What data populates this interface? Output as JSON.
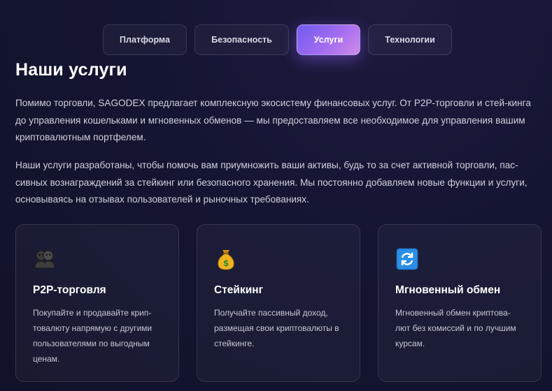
{
  "tabs": [
    {
      "label": "Платформа",
      "active": false
    },
    {
      "label": "Безопасность",
      "active": false
    },
    {
      "label": "Услуги",
      "active": true
    },
    {
      "label": "Технологии",
      "active": false
    }
  ],
  "colors": {
    "background": "#141532",
    "accent_start": "#6f5cf0",
    "accent_end": "#d08ae8",
    "card_border": "#2a2b48"
  },
  "main": {
    "title": "Наши услуги",
    "paragraphs": [
      "Помимо торговли, SAGODEX предлагает комплексную экосистему финансовых услуг. От P2P-торговли и стей-кинга до управления кошельками и мгновенных обменов — мы предоставляем все необходимое для управления вашим криптовалютным портфелем.",
      "Наши услуги разработаны, чтобы помочь вам приумножить ваши активы, будь то за счет активной торговли, пас-сивных вознаграждений за стейкинг или безопасного хранения. Мы постоянно добавляем новые функции и услуги, основываясь на отзывах пользователей и рыночных требованиях."
    ]
  },
  "cards": [
    {
      "icon": "people-icon",
      "title": "P2P-торговля",
      "text": "Покупайте и продавайте крип-товалюту напрямую с другими пользователями по выгодным ценам."
    },
    {
      "icon": "money-bag-icon",
      "title": "Стейкинг",
      "text": "Получайте пассивный доход, размещая свои криптовалюты в стейкинге."
    },
    {
      "icon": "exchange-icon",
      "title": "Мгновенный обмен",
      "text": "Мгновенный обмен криптова-лют без комиссий и по лучшим курсам."
    }
  ]
}
